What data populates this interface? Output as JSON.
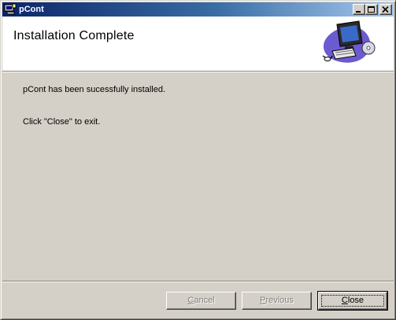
{
  "window": {
    "title": "pCont",
    "icons": {
      "app": "installer-icon",
      "minimize": "minimize-icon",
      "maximize": "maximize-icon",
      "close": "close-icon"
    }
  },
  "header": {
    "title": "Installation Complete",
    "graphic": "computer-setup-icon"
  },
  "body": {
    "line1": "pCont has been sucessfully installed.",
    "line2": "Click \"Close\" to exit."
  },
  "buttons": {
    "cancel": {
      "accel": "C",
      "rest": "ancel",
      "enabled": false
    },
    "previous": {
      "accel": "P",
      "rest": "revious",
      "enabled": false
    },
    "close": {
      "accel": "C",
      "rest": "lose",
      "enabled": true,
      "default": true
    }
  },
  "colors": {
    "face": "#d4d0c8",
    "titlebar_start": "#0a246a",
    "titlebar_end": "#a6caf0",
    "header_bg": "#ffffff"
  }
}
